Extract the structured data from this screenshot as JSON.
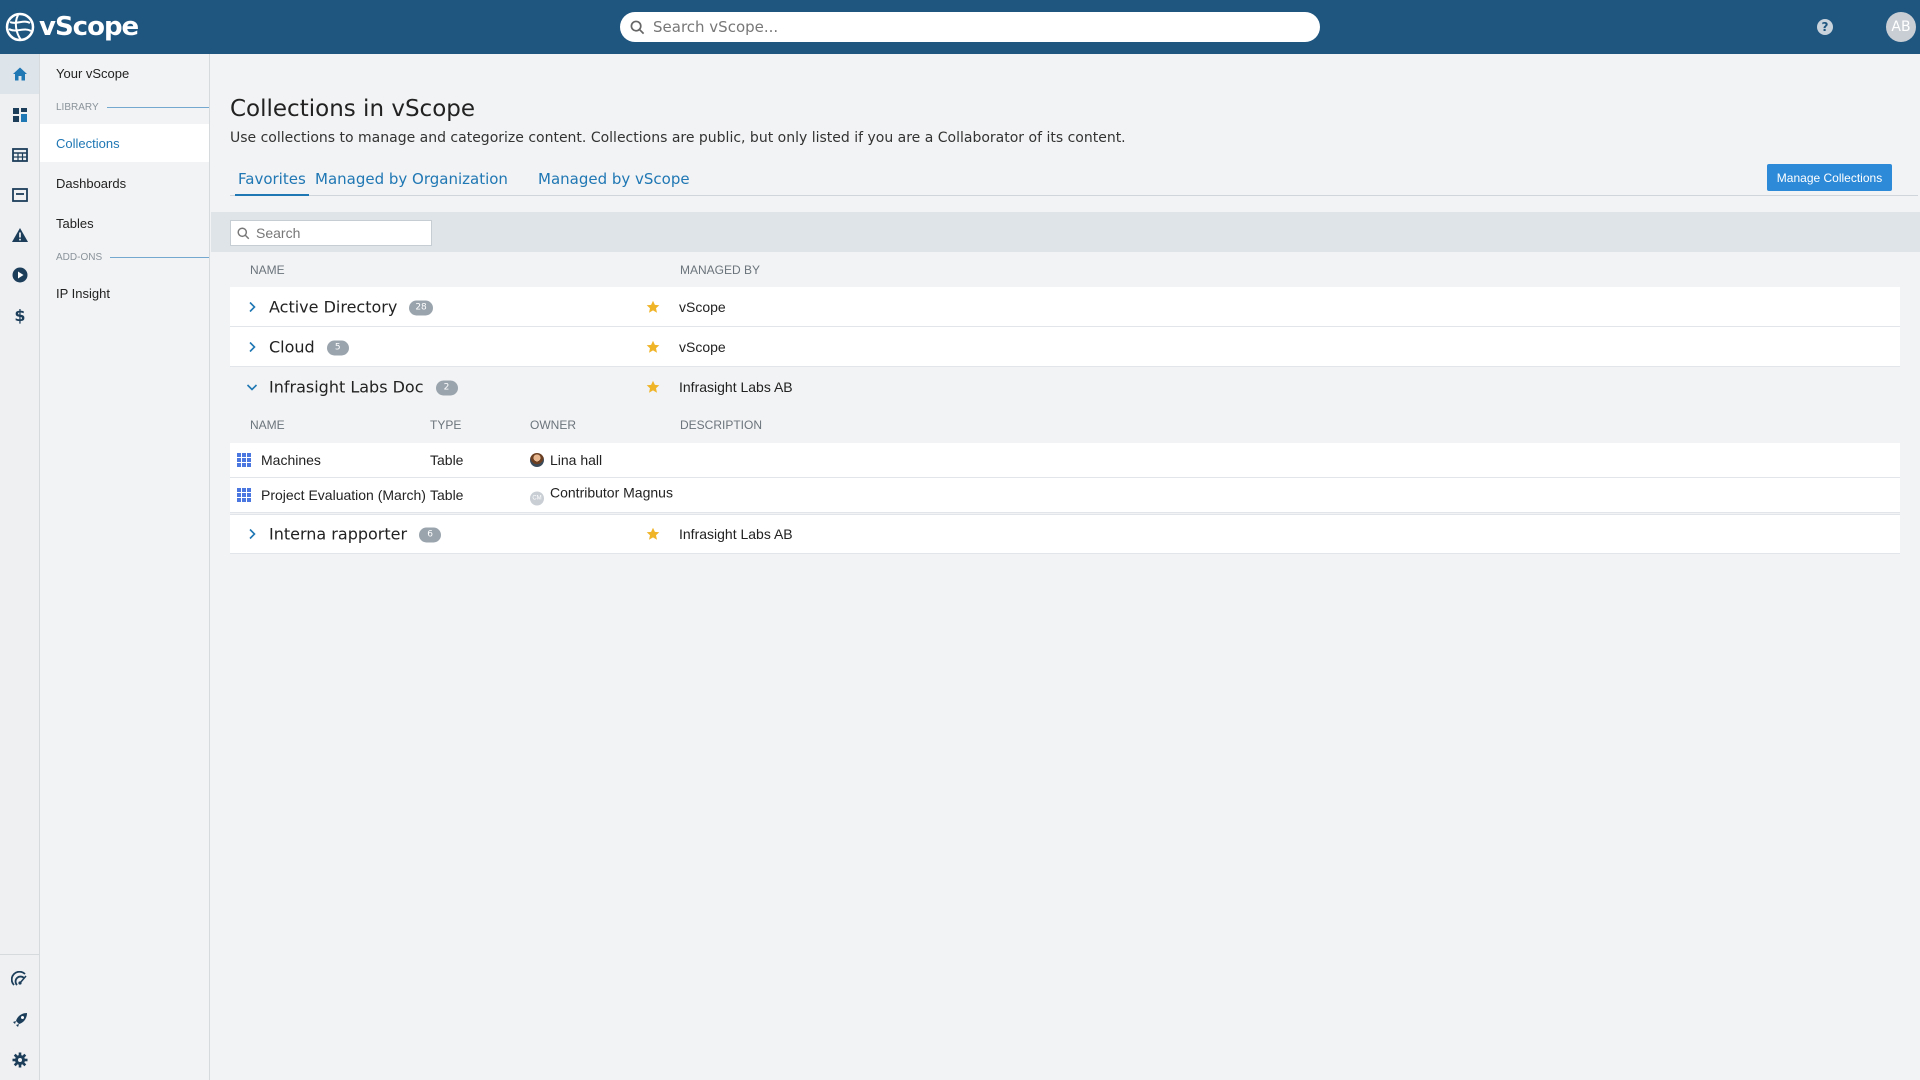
{
  "app": {
    "brand": "vScope",
    "avatar_initials": "AB"
  },
  "search": {
    "placeholder": "Search vScope..."
  },
  "rail_icons": [
    "home-icon",
    "dashboard-icon",
    "table-icon",
    "panel-icon",
    "alert-icon",
    "play-icon",
    "dollar-icon",
    "radar-icon",
    "rocket-icon",
    "gear-icon"
  ],
  "sidebar": {
    "your_vscope": "Your vScope",
    "library_label": "LIBRARY",
    "items": [
      {
        "label": "Collections"
      },
      {
        "label": "Dashboards"
      },
      {
        "label": "Tables"
      }
    ],
    "addons_label": "ADD-ONS",
    "addons": [
      {
        "label": "IP Insight"
      }
    ]
  },
  "page": {
    "title": "Collections in vScope",
    "description": "Use collections to manage and categorize content. Collections are public, but only listed if you are a Collaborator of its content.",
    "tabs": [
      {
        "label": "Favorites"
      },
      {
        "label": "Managed by Organization"
      },
      {
        "label": "Managed by vScope"
      }
    ],
    "manage_button": "Manage Collections",
    "filter_placeholder": "Search"
  },
  "table": {
    "headers": {
      "name": "NAME",
      "managed_by": "MANAGED BY"
    },
    "collections": [
      {
        "name": "Active Directory",
        "count": "28",
        "managed_by": "vScope"
      },
      {
        "name": "Cloud",
        "count": "5",
        "managed_by": "vScope"
      },
      {
        "name": "Infrasight Labs Doc",
        "count": "2",
        "managed_by": "Infrasight Labs AB"
      },
      {
        "name": "Interna rapporter",
        "count": "6",
        "managed_by": "Infrasight Labs AB"
      }
    ],
    "sub_headers": {
      "name": "NAME",
      "type": "TYPE",
      "owner": "OWNER",
      "description": "DESCRIPTION"
    },
    "sub_items": [
      {
        "name": "Machines",
        "type": "Table",
        "owner": "Lina hall",
        "owner_initials": "",
        "description": ""
      },
      {
        "name": "Project Evaluation (March)",
        "type": "Table",
        "owner": "Contributor Magnus",
        "owner_initials": "CM",
        "description": ""
      }
    ]
  },
  "colors": {
    "topbar": "#1f5680",
    "accent": "#1f77b4",
    "button": "#2d8ad8",
    "star": "#f0b429"
  }
}
